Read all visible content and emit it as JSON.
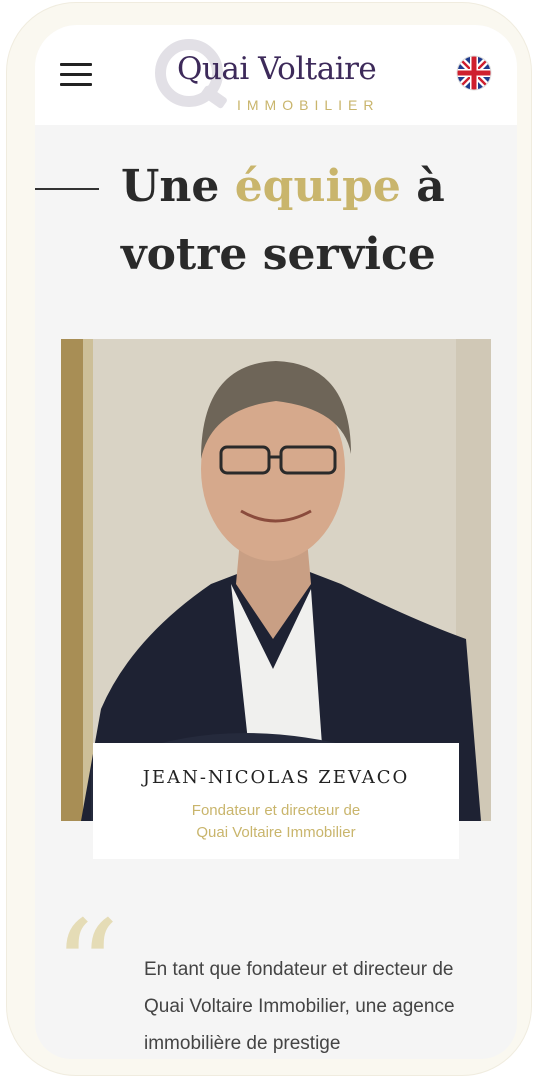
{
  "header": {
    "logo_name": "Quai Voltaire",
    "logo_sub": "IMMOBILIER",
    "menu_icon": "hamburger-menu-icon",
    "language_icon": "uk-flag-icon"
  },
  "hero": {
    "title_part1": "Une ",
    "title_accent": "équipe",
    "title_part2": " à votre service"
  },
  "member": {
    "name": "JEAN-NICOLAS ZEVACO",
    "role_line1": "Fondateur et directeur de",
    "role_line2": "Quai Voltaire Immobilier"
  },
  "quote": {
    "mark": "“",
    "text": "En tant que fondateur et directeur de Quai Voltaire Immobilier, une agence immobilière de prestige"
  },
  "colors": {
    "accent": "#c9b56c",
    "brand": "#3d2a5a",
    "text": "#2a2a2a"
  }
}
